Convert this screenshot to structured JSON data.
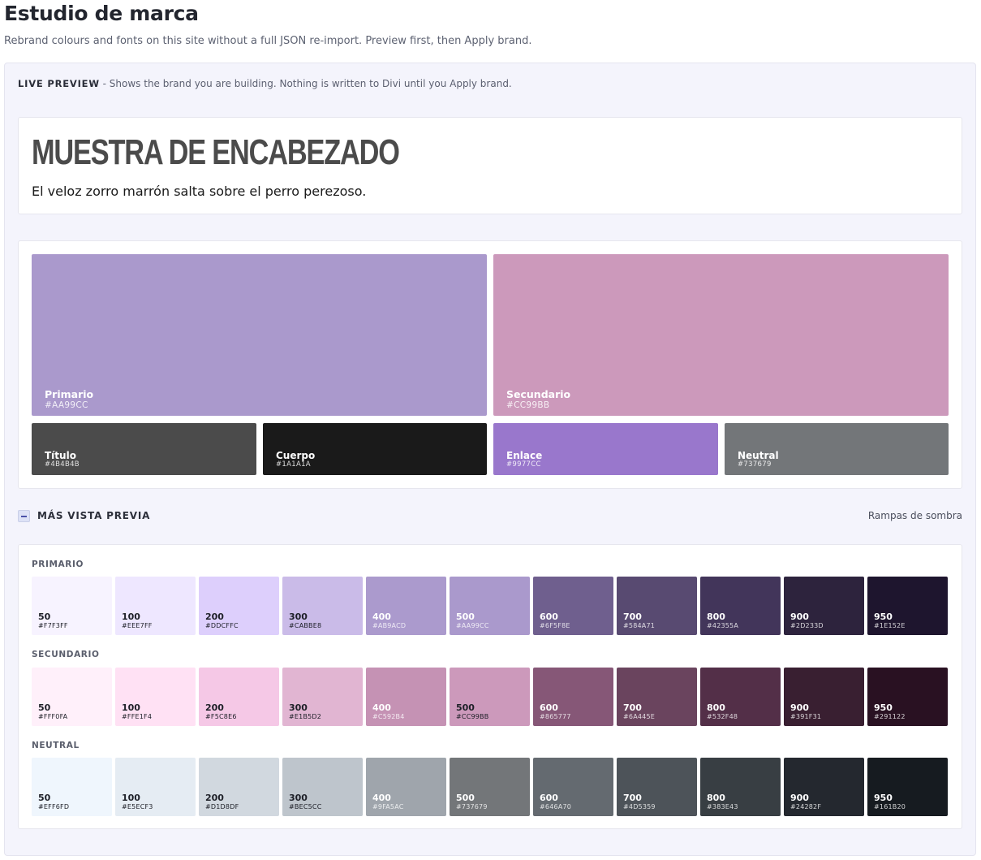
{
  "header": {
    "title": "Estudio de marca",
    "subtitle": "Rebrand colours and fonts on this site without a full JSON re-import. Preview first, then Apply brand."
  },
  "live_preview": {
    "label": "LIVE PREVIEW",
    "separator": " - ",
    "description": "Shows the brand you are building. Nothing is written to Divi until you Apply brand."
  },
  "sample": {
    "heading": "MUESTRA DE ENCABEZADO",
    "body": "El veloz zorro marrón salta sobre el perro perezoso."
  },
  "palette": {
    "primary": {
      "name": "Primario",
      "hex": "#AA99CC",
      "color": "#AA99CC"
    },
    "secondary": {
      "name": "Secundario",
      "hex": "#CC99BB",
      "color": "#CC99BB"
    },
    "heading": {
      "name": "Título",
      "hex": "#4B4B4B",
      "color": "#4B4B4B"
    },
    "body": {
      "name": "Cuerpo",
      "hex": "#1A1A1A",
      "color": "#1A1A1A"
    },
    "link": {
      "name": "Enlace",
      "hex": "#9977CC",
      "color": "#9977CC"
    },
    "neutral": {
      "name": "Neutral",
      "hex": "#737679",
      "color": "#737679"
    }
  },
  "more_preview": {
    "label": "MÁS VISTA PREVIA",
    "toggle_icon": "minus-icon",
    "shade_ramps_label": "Rampas de sombra"
  },
  "ramps": [
    {
      "label": "PRIMARIO",
      "shades": [
        {
          "step": "50",
          "hex": "#F7F3FF"
        },
        {
          "step": "100",
          "hex": "#EEE7FF"
        },
        {
          "step": "200",
          "hex": "#DDCFFC"
        },
        {
          "step": "300",
          "hex": "#CABBE8"
        },
        {
          "step": "400",
          "hex": "#AB9ACD"
        },
        {
          "step": "500",
          "hex": "#AA99CC"
        },
        {
          "step": "600",
          "hex": "#6F5F8E"
        },
        {
          "step": "700",
          "hex": "#584A71"
        },
        {
          "step": "800",
          "hex": "#42355A"
        },
        {
          "step": "900",
          "hex": "#2D233D"
        },
        {
          "step": "950",
          "hex": "#1E152E"
        }
      ]
    },
    {
      "label": "SECUNDARIO",
      "shades": [
        {
          "step": "50",
          "hex": "#FFF0FA"
        },
        {
          "step": "100",
          "hex": "#FFE1F4"
        },
        {
          "step": "200",
          "hex": "#F5C8E6"
        },
        {
          "step": "300",
          "hex": "#E1B5D2"
        },
        {
          "step": "400",
          "hex": "#C592B4"
        },
        {
          "step": "500",
          "hex": "#CC99BB"
        },
        {
          "step": "600",
          "hex": "#865777"
        },
        {
          "step": "700",
          "hex": "#6A445E"
        },
        {
          "step": "800",
          "hex": "#532F48"
        },
        {
          "step": "900",
          "hex": "#391F31"
        },
        {
          "step": "950",
          "hex": "#291122"
        }
      ]
    },
    {
      "label": "NEUTRAL",
      "shades": [
        {
          "step": "50",
          "hex": "#EFF6FD"
        },
        {
          "step": "100",
          "hex": "#E5ECF3"
        },
        {
          "step": "200",
          "hex": "#D1D8DF"
        },
        {
          "step": "300",
          "hex": "#BEC5CC"
        },
        {
          "step": "400",
          "hex": "#9FA5AC"
        },
        {
          "step": "500",
          "hex": "#737679"
        },
        {
          "step": "600",
          "hex": "#646A70"
        },
        {
          "step": "700",
          "hex": "#4D5359"
        },
        {
          "step": "800",
          "hex": "#383E43"
        },
        {
          "step": "900",
          "hex": "#24282F"
        },
        {
          "step": "950",
          "hex": "#161B20"
        }
      ]
    }
  ]
}
